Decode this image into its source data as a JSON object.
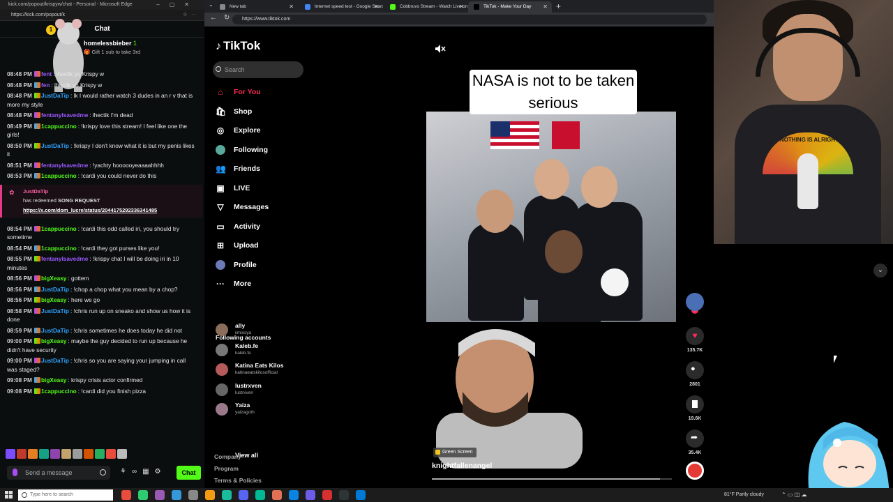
{
  "chat_window": {
    "title": "kick.com/popout/krispyw/chat - Personal - Microsoft Edge",
    "url": "https://kick.com/popout/k",
    "header": "Chat",
    "pinned": {
      "username": "homelessbieber",
      "badge_count": "1",
      "text": "Gift 1 sub to take 3rd"
    },
    "messages": [
      {
        "ts": "08:48 PM",
        "user": "fent",
        "color": "#9b59ff",
        "text": ": lhectik yo Krispy w"
      },
      {
        "ts": "08:48 PM",
        "user": "fen",
        "color": "#9b59ff",
        "text": ": lhectik yo Krispy w"
      },
      {
        "ts": "08:48 PM",
        "user": "JustDaTip",
        "color": "#2fa4ff",
        "text": ": lk  I would rather watch 3 dudes in an r v that is more my style"
      },
      {
        "ts": "08:48 PM",
        "user": "fentanylsavedme",
        "color": "#9b59ff",
        "text": ": lhectik I'm dead"
      },
      {
        "ts": "08:49 PM",
        "user": "1cappuccino",
        "color": "#53fc18",
        "text": ": !krispy love this stream! I feel like one the girls!"
      },
      {
        "ts": "08:50 PM",
        "user": "JustDaTip",
        "color": "#2fa4ff",
        "text": ": !krispy I don't know what it is but my penis likes it"
      },
      {
        "ts": "08:51 PM",
        "user": "fentanylsavedme",
        "color": "#9b59ff",
        "text": ": !yachty hoooooyeaaaahhhh"
      },
      {
        "ts": "08:53 PM",
        "user": "1cappuccino",
        "color": "#53fc18",
        "text": ": !cardi you could never do this"
      }
    ],
    "redeem": {
      "user": "JustDaTip",
      "text_prefix": "has redeemed ",
      "reward": "SONG REQUEST",
      "link": "https://x.com/dom_lucre/status/2044175292336341485"
    },
    "messages_after": [
      {
        "ts": "08:54 PM",
        "user": "1cappuccino",
        "color": "#53fc18",
        "text": ": !cardi this odd called iri, you should try sometime"
      },
      {
        "ts": "08:54 PM",
        "user": "1cappuccino",
        "color": "#53fc18",
        "text": ": !cardi they got purses like you!"
      },
      {
        "ts": "08:55 PM",
        "user": "fentanylsavedme",
        "color": "#9b59ff",
        "text": ": !krispy chat I will be doing iri in 10 minutes"
      },
      {
        "ts": "08:56 PM",
        "user": "bigXeasy",
        "color": "#53fc18",
        "text": ": gottem"
      },
      {
        "ts": "08:56 PM",
        "user": "JustDaTip",
        "color": "#2fa4ff",
        "text": ": !chop a chop what you mean by a chop?"
      },
      {
        "ts": "08:56 PM",
        "user": "bigXeasy",
        "color": "#53fc18",
        "text": ": here we go"
      },
      {
        "ts": "08:58 PM",
        "user": "JustDaTip",
        "color": "#2fa4ff",
        "text": ": !chris run up on sneako and show us how it is done"
      },
      {
        "ts": "08:59 PM",
        "user": "JustDaTip",
        "color": "#2fa4ff",
        "text": ": !chris sometimes he does today he did not"
      },
      {
        "ts": "09:00 PM",
        "user": "bigXeasy",
        "color": "#53fc18",
        "text": ": maybe the guy decided to run up because he didn't have security"
      },
      {
        "ts": "09:00 PM",
        "user": "JustDaTip",
        "color": "#2fa4ff",
        "text": ": !chris so you are saying your jumping in call was staged?"
      },
      {
        "ts": "09:08 PM",
        "user": "bigXeasy",
        "color": "#53fc18",
        "text": ": krispy crisis actor confirmed"
      },
      {
        "ts": "09:08 PM",
        "user": "1cappuccino",
        "color": "#53fc18",
        "text": ": !cardi did you finish pizza"
      }
    ],
    "input_placeholder": "Send a message",
    "send_label": "Chat"
  },
  "browser": {
    "tabs": [
      {
        "label": "New tab",
        "fav_color": "#888"
      },
      {
        "label": "Internet speed test - Google Search",
        "fav_color": "#4285f4"
      },
      {
        "label": "Cobbruvs Stream - Watch Live on Kick",
        "fav_color": "#53fc18"
      },
      {
        "label": "TikTok - Make Your Day",
        "fav_color": "#000"
      }
    ],
    "url": "https://www.tiktok.com"
  },
  "tiktok": {
    "logo": "TikTok",
    "search_placeholder": "Search",
    "nav": [
      {
        "label": "For You",
        "icon": "home-icon",
        "glyph": "⌂"
      },
      {
        "label": "Shop",
        "icon": "shop-icon",
        "glyph": "🛍"
      },
      {
        "label": "Explore",
        "icon": "compass-icon",
        "glyph": "◎"
      },
      {
        "label": "Following",
        "icon": "following-avatar-icon",
        "glyph": "●"
      },
      {
        "label": "Friends",
        "icon": "friends-icon",
        "glyph": "👥"
      },
      {
        "label": "LIVE",
        "icon": "live-icon",
        "glyph": "▣"
      },
      {
        "label": "Messages",
        "icon": "messages-icon",
        "glyph": "▽"
      },
      {
        "label": "Activity",
        "icon": "activity-icon",
        "glyph": "▭"
      },
      {
        "label": "Upload",
        "icon": "upload-icon",
        "glyph": "⊞"
      },
      {
        "label": "Profile",
        "icon": "profile-icon",
        "glyph": "●"
      },
      {
        "label": "More",
        "icon": "more-icon",
        "glyph": "···"
      }
    ],
    "following_title": "Following accounts",
    "following": [
      {
        "name": "ally",
        "handle": "iimissya",
        "avatar": "#8a6d5a"
      },
      {
        "name": "Kaleb.fe",
        "handle": "kaleb.fe",
        "avatar": "#777"
      },
      {
        "name": "Katina Eats Kilos",
        "handle": "katinaeatskilosofficial",
        "avatar": "#b45a5a"
      },
      {
        "name": "lustrxven",
        "handle": "lustrxven",
        "avatar": "#666"
      },
      {
        "name": "Yaiza",
        "handle": "yaizagoth",
        "avatar": "#9a7a8a"
      }
    ],
    "view_all": "View all",
    "footer": [
      "Company",
      "Program",
      "Terms & Policies"
    ],
    "video": {
      "caption": "NASA is not to be taken serious",
      "effect_tag": "Green Screen",
      "author": "knightfallenangel",
      "progress": 0.95
    },
    "rail": {
      "likes": "135.7K",
      "comments": "2801",
      "saves": "19.6K",
      "shares": "35.4K"
    }
  },
  "webcam": {
    "shirt_text": "NOTHING IS ALRIGHT"
  },
  "taskbar": {
    "search_placeholder": "Type here to search",
    "weather": "81°F  Partly cloudy",
    "apps": [
      "#e74c3c",
      "#2ecc71",
      "#9b59b6",
      "#3498db",
      "#888",
      "#f39c12",
      "#1abc9c",
      "#5865f2",
      "#00b894",
      "#e17055",
      "#0984e3",
      "#6c5ce7",
      "#d63031",
      "#2d3436",
      "#0078d4"
    ]
  }
}
